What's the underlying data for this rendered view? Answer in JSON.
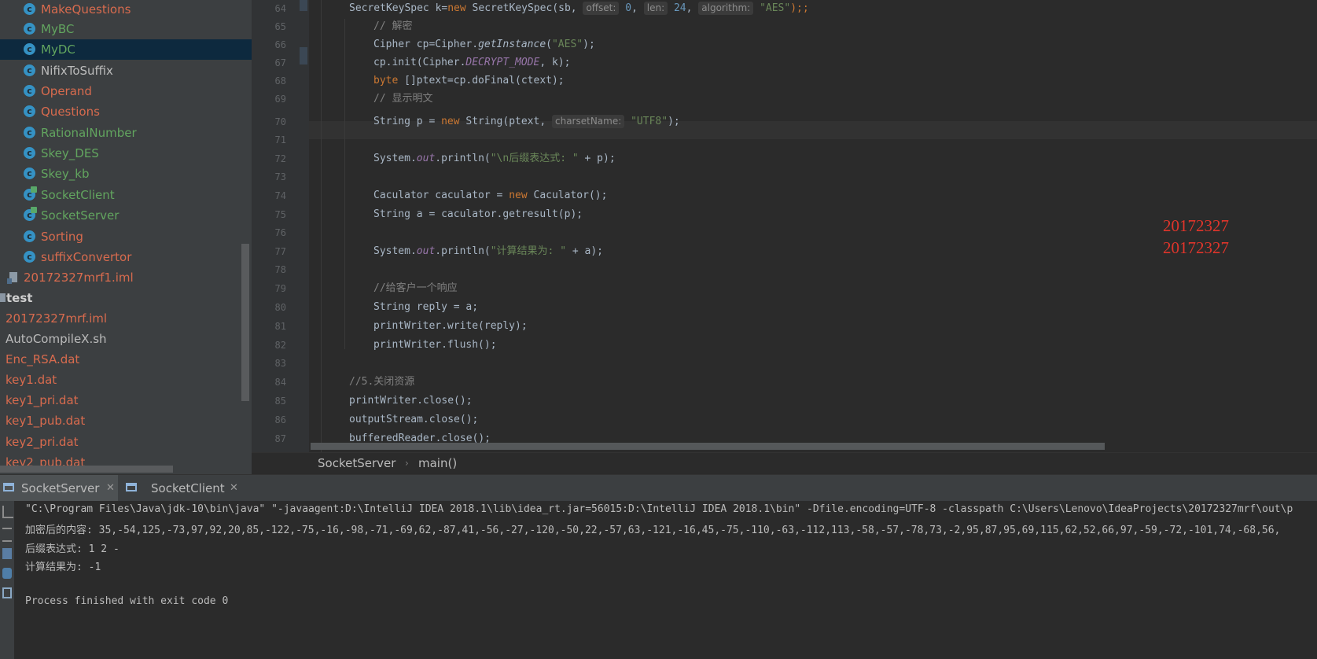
{
  "project_tree": {
    "items": [
      {
        "label": "MakeQuestions",
        "color": "orange",
        "icon": "class-icon"
      },
      {
        "label": "MyBC",
        "color": "green",
        "icon": "class-icon"
      },
      {
        "label": "MyDC",
        "color": "green",
        "icon": "class-icon",
        "selected": true
      },
      {
        "label": "NifixToSuffix",
        "color": "plain",
        "icon": "class-icon"
      },
      {
        "label": "Operand",
        "color": "orange",
        "icon": "class-icon"
      },
      {
        "label": "Questions",
        "color": "orange",
        "icon": "class-icon"
      },
      {
        "label": "RationalNumber",
        "color": "green",
        "icon": "class-icon"
      },
      {
        "label": "Skey_DES",
        "color": "green",
        "icon": "class-icon"
      },
      {
        "label": "Skey_kb",
        "color": "green",
        "icon": "class-icon"
      },
      {
        "label": "SocketClient",
        "color": "green",
        "icon": "class-icon"
      },
      {
        "label": "SocketServer",
        "color": "green",
        "icon": "class-icon"
      },
      {
        "label": "Sorting",
        "color": "orange",
        "icon": "class-icon"
      },
      {
        "label": "suffixConvertor",
        "color": "orange",
        "icon": "class-icon"
      },
      {
        "label": "20172327mrf1.iml",
        "color": "orange",
        "icon": "module-file-icon"
      },
      {
        "label": "test",
        "color": "bold",
        "icon": "folder-icon"
      },
      {
        "label": "20172327mrf.iml",
        "color": "orange",
        "icon": "none"
      },
      {
        "label": "AutoCompileX.sh",
        "color": "plain",
        "icon": "none"
      },
      {
        "label": "Enc_RSA.dat",
        "color": "orange",
        "icon": "none"
      },
      {
        "label": "key1.dat",
        "color": "orange",
        "icon": "none"
      },
      {
        "label": "key1_pri.dat",
        "color": "orange",
        "icon": "none"
      },
      {
        "label": "key1_pub.dat",
        "color": "orange",
        "icon": "none"
      },
      {
        "label": "key2_pri.dat",
        "color": "orange",
        "icon": "none"
      },
      {
        "label": "key2_pub.dat",
        "color": "orange",
        "icon": "none"
      }
    ]
  },
  "editor": {
    "line_numbers": [
      "64",
      "65",
      "66",
      "67",
      "68",
      "69",
      "70",
      "71",
      "72",
      "73",
      "74",
      "75",
      "76",
      "77",
      "78",
      "79",
      "80",
      "81",
      "82",
      "83",
      "84",
      "85",
      "86",
      "87"
    ],
    "code": {
      "l64": {
        "a": "SecretKeySpec k=",
        "kw": "new",
        "b": " SecretKeySpec(sb, ",
        "h1": "offset:",
        "n1": "0",
        "c": ", ",
        "h2": "len:",
        "n2": "24",
        "d": ", ",
        "h3": "algorithm:",
        "s": "\"AES\"",
        "e": ");;"
      },
      "l65": "// 解密",
      "l66": {
        "a": "Cipher cp=Cipher.",
        "m": "getInstance",
        "b": "(",
        "s": "\"AES\"",
        "c": ");"
      },
      "l67": {
        "a": "cp.init(Cipher.",
        "it": "DECRYPT_MODE",
        "b": ", k);"
      },
      "l68": {
        "kw": "byte",
        "a": " []ptext=cp.doFinal(ctext);"
      },
      "l69": "// 显示明文",
      "l70": {
        "a": "String p = ",
        "kw": "new",
        "b": " String(ptext, ",
        "h": "charsetName:",
        "s": "\"UTF8\"",
        "c": ");"
      },
      "l72": {
        "a": "System.",
        "it": "out",
        "b": ".println(",
        "s": "\"\\n后缀表达式: \"",
        "c": " + p);"
      },
      "l74": {
        "a": "Caculator caculator = ",
        "kw": "new",
        "b": " Caculator();"
      },
      "l75": "String a = caculator.getresult(p);",
      "l77": {
        "a": "System.",
        "it": "out",
        "b": ".println(",
        "s": "\"计算结果为: \"",
        "c": " + a);"
      },
      "l79": "//给客户一个响应",
      "l80": "String reply = a;",
      "l81": "printWriter.write(reply);",
      "l82": "printWriter.flush();",
      "l84": "//5.关闭资源",
      "l85": "printWriter.close();",
      "l86": "outputStream.close();",
      "l87": "bufferedReader.close();"
    },
    "watermark": [
      "20172327",
      "20172327"
    ]
  },
  "breadcrumb": {
    "class": "SocketServer",
    "method": "main()"
  },
  "run": {
    "tabs": [
      {
        "label": "SocketServer",
        "active": true
      },
      {
        "label": "SocketClient",
        "active": false
      }
    ],
    "console": [
      "\"C:\\Program Files\\Java\\jdk-10\\bin\\java\" \"-javaagent:D:\\IntelliJ IDEA 2018.1\\lib\\idea_rt.jar=56015:D:\\IntelliJ IDEA 2018.1\\bin\" -Dfile.encoding=UTF-8 -classpath C:\\Users\\Lenovo\\IdeaProjects\\20172327mrf\\out\\p",
      "加密后的内容: 35,-54,125,-73,97,92,20,85,-122,-75,-16,-98,-71,-69,62,-87,41,-56,-27,-120,-50,22,-57,63,-121,-16,45,-75,-110,-63,-112,113,-58,-57,-78,73,-2,95,87,95,69,115,62,52,66,97,-59,-72,-101,74,-68,56,",
      "后缀表达式: 1 2 -",
      "计算结果为: -1",
      "",
      "Process finished with exit code 0"
    ]
  },
  "colors": {
    "orange": "#d86b4e",
    "green": "#62a55f",
    "keyword": "#cc7832",
    "string": "#6a8759",
    "number": "#6897bb",
    "watermark": "#e0352b"
  }
}
